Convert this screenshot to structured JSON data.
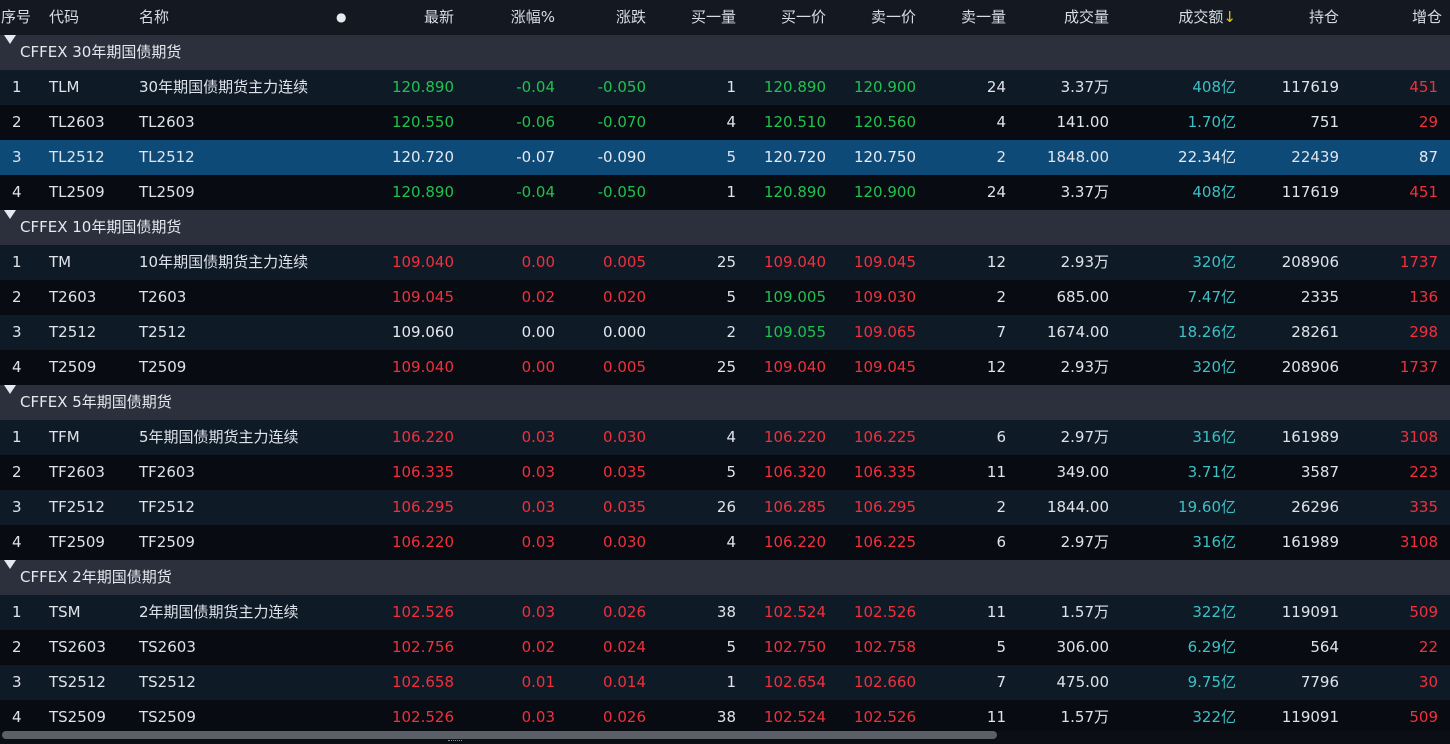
{
  "columns": {
    "seq": "序号",
    "code": "代码",
    "name": "名称",
    "dot": "●",
    "last": "最新",
    "chg_pct": "涨幅%",
    "chg": "涨跌",
    "bid_vol": "买一量",
    "bid": "买一价",
    "ask": "卖一价",
    "ask_vol": "卖一量",
    "volume": "成交量",
    "turnover": "成交额",
    "turnover_sort_icon": "↓",
    "oi": "持仓",
    "oi_chg": "增仓"
  },
  "colors": {
    "up": "#f0303c",
    "down": "#22c14f",
    "flat": "#e6e9ef",
    "amount": "#3cc0c4",
    "selected_row": "#0e4a78"
  },
  "groups": [
    {
      "title": "CFFEX 30年期国债期货",
      "rows": [
        {
          "seq": "1",
          "code": "TLM",
          "name": "30年期国债期货主力连续",
          "last": "120.890",
          "chg_pct": "-0.04",
          "chg": "-0.050",
          "bid_vol": "1",
          "bid": "120.890",
          "ask": "120.900",
          "ask_vol": "24",
          "volume": "3.37万",
          "turnover": "408亿",
          "oi": "117619",
          "oi_chg": "451",
          "c": {
            "last": "green",
            "chg_pct": "green",
            "chg": "green",
            "bid": "green",
            "ask": "green",
            "oi_chg": "red"
          }
        },
        {
          "seq": "2",
          "code": "TL2603",
          "name": "TL2603",
          "last": "120.550",
          "chg_pct": "-0.06",
          "chg": "-0.070",
          "bid_vol": "4",
          "bid": "120.510",
          "ask": "120.560",
          "ask_vol": "4",
          "volume": "141.00",
          "turnover": "1.70亿",
          "oi": "751",
          "oi_chg": "29",
          "c": {
            "last": "green",
            "chg_pct": "green",
            "chg": "green",
            "bid": "green",
            "ask": "green",
            "oi_chg": "red"
          }
        },
        {
          "seq": "3",
          "code": "TL2512",
          "name": "TL2512",
          "last": "120.720",
          "chg_pct": "-0.07",
          "chg": "-0.090",
          "bid_vol": "5",
          "bid": "120.720",
          "ask": "120.750",
          "ask_vol": "2",
          "volume": "1848.00",
          "turnover": "22.34亿",
          "oi": "22439",
          "oi_chg": "87",
          "selected": true,
          "c": {
            "last": "white",
            "chg_pct": "white",
            "chg": "white",
            "bid": "white",
            "ask": "white",
            "oi_chg": "white",
            "turnover": "white"
          }
        },
        {
          "seq": "4",
          "code": "TL2509",
          "name": "TL2509",
          "last": "120.890",
          "chg_pct": "-0.04",
          "chg": "-0.050",
          "bid_vol": "1",
          "bid": "120.890",
          "ask": "120.900",
          "ask_vol": "24",
          "volume": "3.37万",
          "turnover": "408亿",
          "oi": "117619",
          "oi_chg": "451",
          "c": {
            "last": "green",
            "chg_pct": "green",
            "chg": "green",
            "bid": "green",
            "ask": "green",
            "oi_chg": "red"
          }
        }
      ]
    },
    {
      "title": "CFFEX 10年期国债期货",
      "rows": [
        {
          "seq": "1",
          "code": "TM",
          "name": "10年期国债期货主力连续",
          "last": "109.040",
          "chg_pct": "0.00",
          "chg": "0.005",
          "bid_vol": "25",
          "bid": "109.040",
          "ask": "109.045",
          "ask_vol": "12",
          "volume": "2.93万",
          "turnover": "320亿",
          "oi": "208906",
          "oi_chg": "1737",
          "c": {
            "last": "red",
            "chg_pct": "red",
            "chg": "red",
            "bid": "red",
            "ask": "red",
            "oi_chg": "red"
          }
        },
        {
          "seq": "2",
          "code": "T2603",
          "name": "T2603",
          "last": "109.045",
          "chg_pct": "0.02",
          "chg": "0.020",
          "bid_vol": "5",
          "bid": "109.005",
          "ask": "109.030",
          "ask_vol": "2",
          "volume": "685.00",
          "turnover": "7.47亿",
          "oi": "2335",
          "oi_chg": "136",
          "c": {
            "last": "red",
            "chg_pct": "red",
            "chg": "red",
            "bid": "green",
            "ask": "red",
            "oi_chg": "red"
          }
        },
        {
          "seq": "3",
          "code": "T2512",
          "name": "T2512",
          "last": "109.060",
          "chg_pct": "0.00",
          "chg": "0.000",
          "bid_vol": "2",
          "bid": "109.055",
          "ask": "109.065",
          "ask_vol": "7",
          "volume": "1674.00",
          "turnover": "18.26亿",
          "oi": "28261",
          "oi_chg": "298",
          "c": {
            "last": "white",
            "chg_pct": "white",
            "chg": "white",
            "bid": "green",
            "ask": "red",
            "oi_chg": "red"
          }
        },
        {
          "seq": "4",
          "code": "T2509",
          "name": "T2509",
          "last": "109.040",
          "chg_pct": "0.00",
          "chg": "0.005",
          "bid_vol": "25",
          "bid": "109.040",
          "ask": "109.045",
          "ask_vol": "12",
          "volume": "2.93万",
          "turnover": "320亿",
          "oi": "208906",
          "oi_chg": "1737",
          "c": {
            "last": "red",
            "chg_pct": "red",
            "chg": "red",
            "bid": "red",
            "ask": "red",
            "oi_chg": "red"
          }
        }
      ]
    },
    {
      "title": "CFFEX 5年期国债期货",
      "rows": [
        {
          "seq": "1",
          "code": "TFM",
          "name": "5年期国债期货主力连续",
          "last": "106.220",
          "chg_pct": "0.03",
          "chg": "0.030",
          "bid_vol": "4",
          "bid": "106.220",
          "ask": "106.225",
          "ask_vol": "6",
          "volume": "2.97万",
          "turnover": "316亿",
          "oi": "161989",
          "oi_chg": "3108",
          "c": {
            "last": "red",
            "chg_pct": "red",
            "chg": "red",
            "bid": "red",
            "ask": "red",
            "oi_chg": "red"
          }
        },
        {
          "seq": "2",
          "code": "TF2603",
          "name": "TF2603",
          "last": "106.335",
          "chg_pct": "0.03",
          "chg": "0.035",
          "bid_vol": "5",
          "bid": "106.320",
          "ask": "106.335",
          "ask_vol": "11",
          "volume": "349.00",
          "turnover": "3.71亿",
          "oi": "3587",
          "oi_chg": "223",
          "c": {
            "last": "red",
            "chg_pct": "red",
            "chg": "red",
            "bid": "red",
            "ask": "red",
            "oi_chg": "red"
          }
        },
        {
          "seq": "3",
          "code": "TF2512",
          "name": "TF2512",
          "last": "106.295",
          "chg_pct": "0.03",
          "chg": "0.035",
          "bid_vol": "26",
          "bid": "106.285",
          "ask": "106.295",
          "ask_vol": "2",
          "volume": "1844.00",
          "turnover": "19.60亿",
          "oi": "26296",
          "oi_chg": "335",
          "c": {
            "last": "red",
            "chg_pct": "red",
            "chg": "red",
            "bid": "red",
            "ask": "red",
            "oi_chg": "red"
          }
        },
        {
          "seq": "4",
          "code": "TF2509",
          "name": "TF2509",
          "last": "106.220",
          "chg_pct": "0.03",
          "chg": "0.030",
          "bid_vol": "4",
          "bid": "106.220",
          "ask": "106.225",
          "ask_vol": "6",
          "volume": "2.97万",
          "turnover": "316亿",
          "oi": "161989",
          "oi_chg": "3108",
          "c": {
            "last": "red",
            "chg_pct": "red",
            "chg": "red",
            "bid": "red",
            "ask": "red",
            "oi_chg": "red"
          }
        }
      ]
    },
    {
      "title": "CFFEX 2年期国债期货",
      "rows": [
        {
          "seq": "1",
          "code": "TSM",
          "name": "2年期国债期货主力连续",
          "last": "102.526",
          "chg_pct": "0.03",
          "chg": "0.026",
          "bid_vol": "38",
          "bid": "102.524",
          "ask": "102.526",
          "ask_vol": "11",
          "volume": "1.57万",
          "turnover": "322亿",
          "oi": "119091",
          "oi_chg": "509",
          "c": {
            "last": "red",
            "chg_pct": "red",
            "chg": "red",
            "bid": "red",
            "ask": "red",
            "oi_chg": "red"
          }
        },
        {
          "seq": "2",
          "code": "TS2603",
          "name": "TS2603",
          "last": "102.756",
          "chg_pct": "0.02",
          "chg": "0.024",
          "bid_vol": "5",
          "bid": "102.750",
          "ask": "102.758",
          "ask_vol": "5",
          "volume": "306.00",
          "turnover": "6.29亿",
          "oi": "564",
          "oi_chg": "22",
          "c": {
            "last": "red",
            "chg_pct": "red",
            "chg": "red",
            "bid": "red",
            "ask": "red",
            "oi_chg": "red"
          }
        },
        {
          "seq": "3",
          "code": "TS2512",
          "name": "TS2512",
          "last": "102.658",
          "chg_pct": "0.01",
          "chg": "0.014",
          "bid_vol": "1",
          "bid": "102.654",
          "ask": "102.660",
          "ask_vol": "7",
          "volume": "475.00",
          "turnover": "9.75亿",
          "oi": "7796",
          "oi_chg": "30",
          "c": {
            "last": "red",
            "chg_pct": "red",
            "chg": "red",
            "bid": "red",
            "ask": "red",
            "oi_chg": "red"
          }
        },
        {
          "seq": "4",
          "code": "TS2509",
          "name": "TS2509",
          "last": "102.526",
          "chg_pct": "0.03",
          "chg": "0.026",
          "bid_vol": "38",
          "bid": "102.524",
          "ask": "102.526",
          "ask_vol": "11",
          "volume": "1.57万",
          "turnover": "322亿",
          "oi": "119091",
          "oi_chg": "509",
          "c": {
            "last": "red",
            "chg_pct": "red",
            "chg": "red",
            "bid": "red",
            "ask": "red",
            "oi_chg": "red"
          }
        }
      ]
    }
  ]
}
